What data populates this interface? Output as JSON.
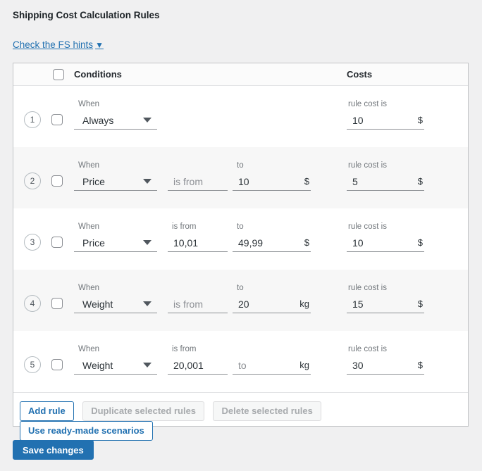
{
  "page": {
    "title": "Shipping Cost Calculation Rules",
    "hints_link": {
      "text": "Check the FS hints",
      "caret": "▼"
    },
    "save_button": "Save changes"
  },
  "table": {
    "headers": {
      "conditions": "Conditions",
      "costs": "Costs"
    },
    "when_label": "When",
    "rules": [
      {
        "number": "1",
        "when_value": "Always",
        "fields": [],
        "cost": {
          "label": "rule cost is",
          "value": "10",
          "unit": "$"
        }
      },
      {
        "number": "2",
        "when_value": "Price",
        "fields": [
          {
            "label": "",
            "value": "",
            "placeholder": "is from",
            "unit": ""
          },
          {
            "label": "to",
            "value": "10",
            "placeholder": "",
            "unit": "$"
          }
        ],
        "cost": {
          "label": "rule cost is",
          "value": "5",
          "unit": "$"
        }
      },
      {
        "number": "3",
        "when_value": "Price",
        "fields": [
          {
            "label": "is from",
            "value": "10,01",
            "placeholder": "",
            "unit": ""
          },
          {
            "label": "to",
            "value": "49,99",
            "placeholder": "",
            "unit": "$"
          }
        ],
        "cost": {
          "label": "rule cost is",
          "value": "10",
          "unit": "$"
        }
      },
      {
        "number": "4",
        "when_value": "Weight",
        "fields": [
          {
            "label": "",
            "value": "",
            "placeholder": "is from",
            "unit": ""
          },
          {
            "label": "to",
            "value": "20",
            "placeholder": "",
            "unit": "kg"
          }
        ],
        "cost": {
          "label": "rule cost is",
          "value": "15",
          "unit": "$"
        }
      },
      {
        "number": "5",
        "when_value": "Weight",
        "fields": [
          {
            "label": "is from",
            "value": "20,001",
            "placeholder": "",
            "unit": ""
          },
          {
            "label": "",
            "value": "",
            "placeholder": "to",
            "unit": "kg"
          }
        ],
        "cost": {
          "label": "rule cost is",
          "value": "30",
          "unit": "$"
        }
      }
    ],
    "footer_buttons": [
      {
        "label": "Add rule",
        "enabled": true
      },
      {
        "label": "Duplicate selected rules",
        "enabled": false
      },
      {
        "label": "Delete selected rules",
        "enabled": false
      },
      {
        "label": "Use ready-made scenarios",
        "enabled": true
      }
    ]
  },
  "colors": {
    "accent": "#2271b1",
    "row_alt": "#f7f7f7",
    "table_border": "#c3c4c7",
    "page_background": "#f0f0f1"
  }
}
